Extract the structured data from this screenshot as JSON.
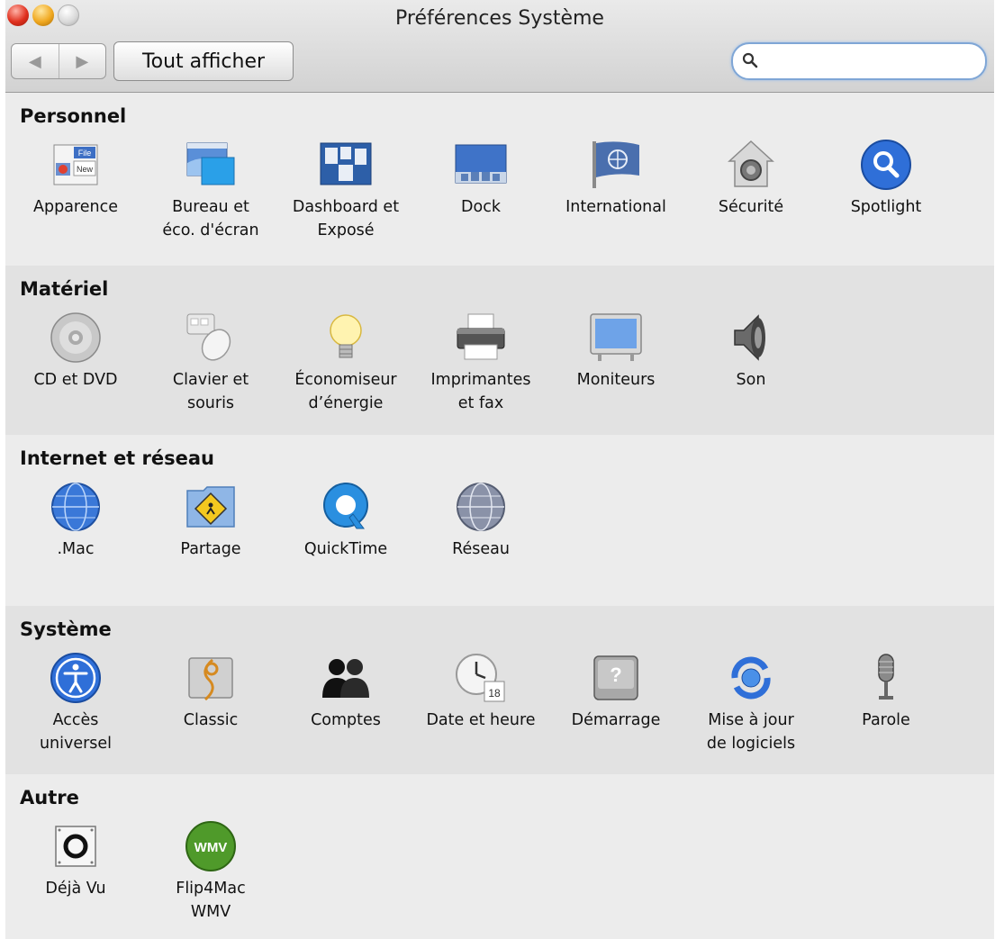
{
  "window": {
    "title": "Préférences Système"
  },
  "toolbar": {
    "back_glyph": "◀",
    "forward_glyph": "▶",
    "show_all_label": "Tout afficher",
    "search": {
      "value": "",
      "placeholder": ""
    }
  },
  "sections": [
    {
      "title": "Personnel",
      "items": [
        {
          "label": "Apparence",
          "icon": "appearance-icon"
        },
        {
          "label": "Bureau et\néco. d'écran",
          "icon": "desktop-screensaver-icon"
        },
        {
          "label": "Dashboard et\nExposé",
          "icon": "dashboard-expose-icon"
        },
        {
          "label": "Dock",
          "icon": "dock-icon"
        },
        {
          "label": "International",
          "icon": "international-flag-icon"
        },
        {
          "label": "Sécurité",
          "icon": "security-house-icon"
        },
        {
          "label": "Spotlight",
          "icon": "spotlight-icon"
        }
      ]
    },
    {
      "title": "Matériel",
      "items": [
        {
          "label": "CD et DVD",
          "icon": "cd-dvd-icon"
        },
        {
          "label": "Clavier et\nsouris",
          "icon": "keyboard-mouse-icon"
        },
        {
          "label": "Économiseur\nd’énergie",
          "icon": "lightbulb-icon"
        },
        {
          "label": "Imprimantes\net fax",
          "icon": "printer-icon"
        },
        {
          "label": "Moniteurs",
          "icon": "monitor-icon"
        },
        {
          "label": "Son",
          "icon": "speaker-icon"
        }
      ]
    },
    {
      "title": "Internet et réseau",
      "items": [
        {
          "label": ".Mac",
          "icon": "dotmac-globe-icon"
        },
        {
          "label": "Partage",
          "icon": "sharing-folder-icon"
        },
        {
          "label": "QuickTime",
          "icon": "quicktime-icon"
        },
        {
          "label": "Réseau",
          "icon": "network-globe-icon"
        }
      ]
    },
    {
      "title": "Système",
      "items": [
        {
          "label": "Accès\nuniversel",
          "icon": "universal-access-icon"
        },
        {
          "label": "Classic",
          "icon": "classic-icon"
        },
        {
          "label": "Comptes",
          "icon": "accounts-icon"
        },
        {
          "label": "Date et heure",
          "icon": "date-time-icon",
          "icon_text": "18"
        },
        {
          "label": "Démarrage",
          "icon": "startup-disk-icon"
        },
        {
          "label": "Mise à jour\nde logiciels",
          "icon": "software-update-icon"
        },
        {
          "label": "Parole",
          "icon": "microphone-icon"
        }
      ]
    },
    {
      "title": "Autre",
      "items": [
        {
          "label": "Déjà Vu",
          "icon": "dejavu-icon"
        },
        {
          "label": "Flip4Mac\nWMV",
          "icon": "flip4mac-wmv-icon",
          "icon_text": "WMV"
        }
      ]
    }
  ],
  "icon_labels": {
    "appearance_file": "File",
    "appearance_new": "New"
  },
  "colors": {
    "accent_blue": "#2f6fd8",
    "search_focus": "#7fa6d6",
    "wmv_green": "#4f9a2a"
  }
}
